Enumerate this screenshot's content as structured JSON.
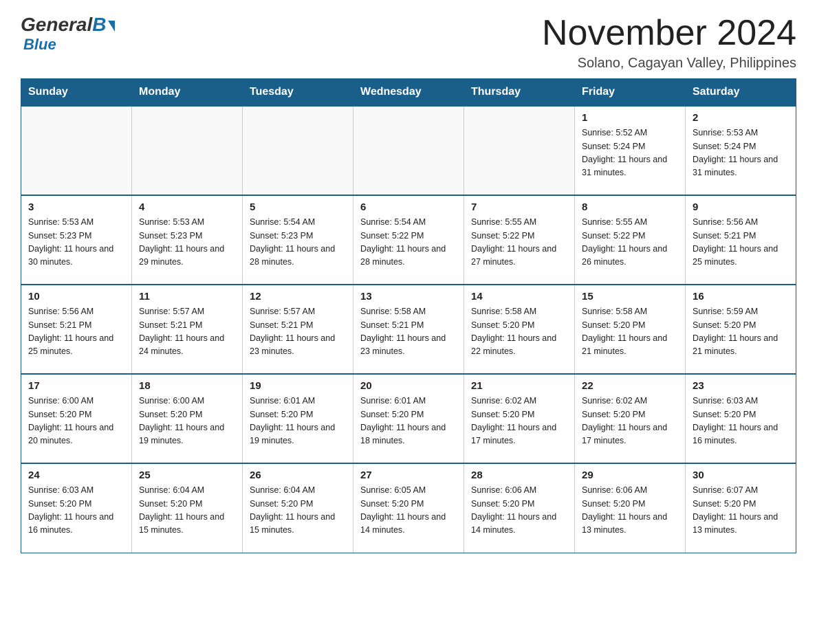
{
  "logo": {
    "general": "General",
    "blue": "Blue"
  },
  "header": {
    "month_title": "November 2024",
    "location": "Solano, Cagayan Valley, Philippines"
  },
  "days_of_week": [
    "Sunday",
    "Monday",
    "Tuesday",
    "Wednesday",
    "Thursday",
    "Friday",
    "Saturday"
  ],
  "weeks": [
    [
      {
        "day": "",
        "sunrise": "",
        "sunset": "",
        "daylight": "",
        "empty": true
      },
      {
        "day": "",
        "sunrise": "",
        "sunset": "",
        "daylight": "",
        "empty": true
      },
      {
        "day": "",
        "sunrise": "",
        "sunset": "",
        "daylight": "",
        "empty": true
      },
      {
        "day": "",
        "sunrise": "",
        "sunset": "",
        "daylight": "",
        "empty": true
      },
      {
        "day": "",
        "sunrise": "",
        "sunset": "",
        "daylight": "",
        "empty": true
      },
      {
        "day": "1",
        "sunrise": "Sunrise: 5:52 AM",
        "sunset": "Sunset: 5:24 PM",
        "daylight": "Daylight: 11 hours and 31 minutes.",
        "empty": false
      },
      {
        "day": "2",
        "sunrise": "Sunrise: 5:53 AM",
        "sunset": "Sunset: 5:24 PM",
        "daylight": "Daylight: 11 hours and 31 minutes.",
        "empty": false
      }
    ],
    [
      {
        "day": "3",
        "sunrise": "Sunrise: 5:53 AM",
        "sunset": "Sunset: 5:23 PM",
        "daylight": "Daylight: 11 hours and 30 minutes.",
        "empty": false
      },
      {
        "day": "4",
        "sunrise": "Sunrise: 5:53 AM",
        "sunset": "Sunset: 5:23 PM",
        "daylight": "Daylight: 11 hours and 29 minutes.",
        "empty": false
      },
      {
        "day": "5",
        "sunrise": "Sunrise: 5:54 AM",
        "sunset": "Sunset: 5:23 PM",
        "daylight": "Daylight: 11 hours and 28 minutes.",
        "empty": false
      },
      {
        "day": "6",
        "sunrise": "Sunrise: 5:54 AM",
        "sunset": "Sunset: 5:22 PM",
        "daylight": "Daylight: 11 hours and 28 minutes.",
        "empty": false
      },
      {
        "day": "7",
        "sunrise": "Sunrise: 5:55 AM",
        "sunset": "Sunset: 5:22 PM",
        "daylight": "Daylight: 11 hours and 27 minutes.",
        "empty": false
      },
      {
        "day": "8",
        "sunrise": "Sunrise: 5:55 AM",
        "sunset": "Sunset: 5:22 PM",
        "daylight": "Daylight: 11 hours and 26 minutes.",
        "empty": false
      },
      {
        "day": "9",
        "sunrise": "Sunrise: 5:56 AM",
        "sunset": "Sunset: 5:21 PM",
        "daylight": "Daylight: 11 hours and 25 minutes.",
        "empty": false
      }
    ],
    [
      {
        "day": "10",
        "sunrise": "Sunrise: 5:56 AM",
        "sunset": "Sunset: 5:21 PM",
        "daylight": "Daylight: 11 hours and 25 minutes.",
        "empty": false
      },
      {
        "day": "11",
        "sunrise": "Sunrise: 5:57 AM",
        "sunset": "Sunset: 5:21 PM",
        "daylight": "Daylight: 11 hours and 24 minutes.",
        "empty": false
      },
      {
        "day": "12",
        "sunrise": "Sunrise: 5:57 AM",
        "sunset": "Sunset: 5:21 PM",
        "daylight": "Daylight: 11 hours and 23 minutes.",
        "empty": false
      },
      {
        "day": "13",
        "sunrise": "Sunrise: 5:58 AM",
        "sunset": "Sunset: 5:21 PM",
        "daylight": "Daylight: 11 hours and 23 minutes.",
        "empty": false
      },
      {
        "day": "14",
        "sunrise": "Sunrise: 5:58 AM",
        "sunset": "Sunset: 5:20 PM",
        "daylight": "Daylight: 11 hours and 22 minutes.",
        "empty": false
      },
      {
        "day": "15",
        "sunrise": "Sunrise: 5:58 AM",
        "sunset": "Sunset: 5:20 PM",
        "daylight": "Daylight: 11 hours and 21 minutes.",
        "empty": false
      },
      {
        "day": "16",
        "sunrise": "Sunrise: 5:59 AM",
        "sunset": "Sunset: 5:20 PM",
        "daylight": "Daylight: 11 hours and 21 minutes.",
        "empty": false
      }
    ],
    [
      {
        "day": "17",
        "sunrise": "Sunrise: 6:00 AM",
        "sunset": "Sunset: 5:20 PM",
        "daylight": "Daylight: 11 hours and 20 minutes.",
        "empty": false
      },
      {
        "day": "18",
        "sunrise": "Sunrise: 6:00 AM",
        "sunset": "Sunset: 5:20 PM",
        "daylight": "Daylight: 11 hours and 19 minutes.",
        "empty": false
      },
      {
        "day": "19",
        "sunrise": "Sunrise: 6:01 AM",
        "sunset": "Sunset: 5:20 PM",
        "daylight": "Daylight: 11 hours and 19 minutes.",
        "empty": false
      },
      {
        "day": "20",
        "sunrise": "Sunrise: 6:01 AM",
        "sunset": "Sunset: 5:20 PM",
        "daylight": "Daylight: 11 hours and 18 minutes.",
        "empty": false
      },
      {
        "day": "21",
        "sunrise": "Sunrise: 6:02 AM",
        "sunset": "Sunset: 5:20 PM",
        "daylight": "Daylight: 11 hours and 17 minutes.",
        "empty": false
      },
      {
        "day": "22",
        "sunrise": "Sunrise: 6:02 AM",
        "sunset": "Sunset: 5:20 PM",
        "daylight": "Daylight: 11 hours and 17 minutes.",
        "empty": false
      },
      {
        "day": "23",
        "sunrise": "Sunrise: 6:03 AM",
        "sunset": "Sunset: 5:20 PM",
        "daylight": "Daylight: 11 hours and 16 minutes.",
        "empty": false
      }
    ],
    [
      {
        "day": "24",
        "sunrise": "Sunrise: 6:03 AM",
        "sunset": "Sunset: 5:20 PM",
        "daylight": "Daylight: 11 hours and 16 minutes.",
        "empty": false
      },
      {
        "day": "25",
        "sunrise": "Sunrise: 6:04 AM",
        "sunset": "Sunset: 5:20 PM",
        "daylight": "Daylight: 11 hours and 15 minutes.",
        "empty": false
      },
      {
        "day": "26",
        "sunrise": "Sunrise: 6:04 AM",
        "sunset": "Sunset: 5:20 PM",
        "daylight": "Daylight: 11 hours and 15 minutes.",
        "empty": false
      },
      {
        "day": "27",
        "sunrise": "Sunrise: 6:05 AM",
        "sunset": "Sunset: 5:20 PM",
        "daylight": "Daylight: 11 hours and 14 minutes.",
        "empty": false
      },
      {
        "day": "28",
        "sunrise": "Sunrise: 6:06 AM",
        "sunset": "Sunset: 5:20 PM",
        "daylight": "Daylight: 11 hours and 14 minutes.",
        "empty": false
      },
      {
        "day": "29",
        "sunrise": "Sunrise: 6:06 AM",
        "sunset": "Sunset: 5:20 PM",
        "daylight": "Daylight: 11 hours and 13 minutes.",
        "empty": false
      },
      {
        "day": "30",
        "sunrise": "Sunrise: 6:07 AM",
        "sunset": "Sunset: 5:20 PM",
        "daylight": "Daylight: 11 hours and 13 minutes.",
        "empty": false
      }
    ]
  ]
}
